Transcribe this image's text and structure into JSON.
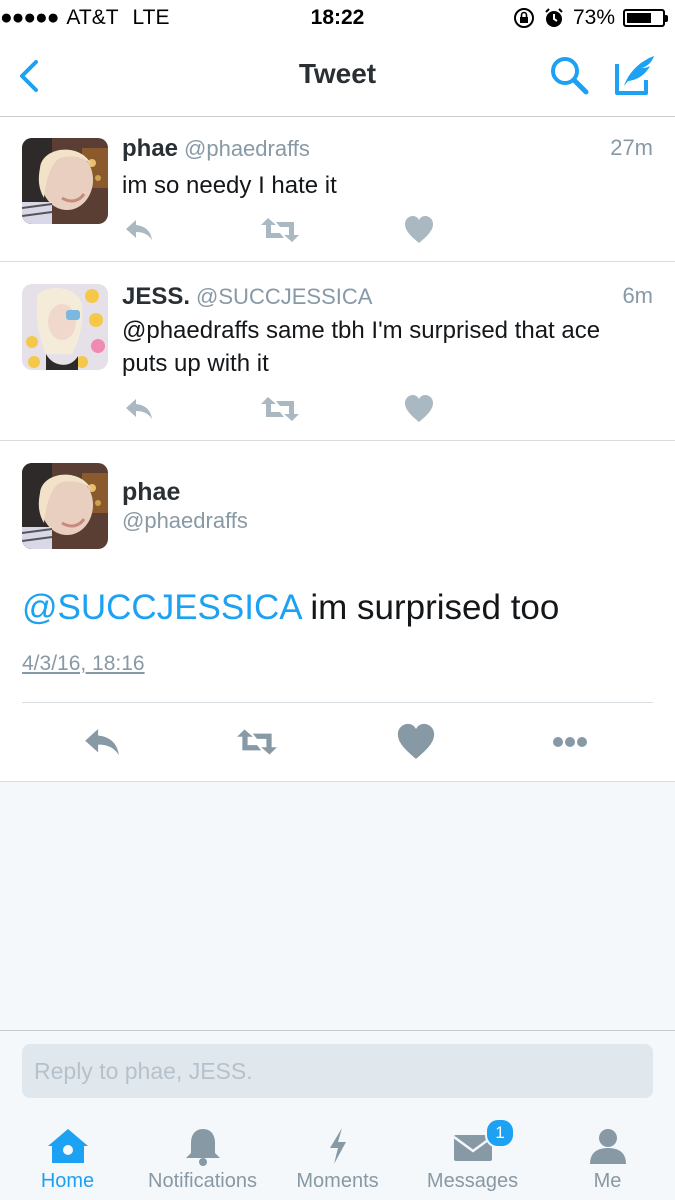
{
  "status_bar": {
    "signal": "●●●●●",
    "carrier": "AT&T",
    "network": "LTE",
    "time": "18:22",
    "battery": "73%",
    "battery_level": 0.73
  },
  "nav": {
    "title": "Tweet",
    "back_icon": "chevron-left-icon",
    "search_icon": "search-icon",
    "compose_icon": "compose-icon"
  },
  "tweets": [
    {
      "name": "phae",
      "handle": "@phaedraffs",
      "time": "27m",
      "text": "im so needy I hate it"
    },
    {
      "name": "JESS.",
      "handle": "@SUCCJESSICA",
      "time": "6m",
      "text": "@phaedraffs same tbh I'm surprised that ace puts up with it"
    }
  ],
  "main_tweet": {
    "name": "phae",
    "handle": "@phaedraffs",
    "mention": "@SUCCJESSICA",
    "text": " im surprised too",
    "date": "4/3/16, 18:16"
  },
  "reply": {
    "placeholder": "Reply to phae, JESS."
  },
  "tabs": [
    {
      "label": "Home",
      "icon": "home-icon",
      "active": true
    },
    {
      "label": "Notifications",
      "icon": "bell-icon",
      "active": false
    },
    {
      "label": "Moments",
      "icon": "lightning-icon",
      "active": false
    },
    {
      "label": "Messages",
      "icon": "envelope-icon",
      "active": false,
      "badge": "1"
    },
    {
      "label": "Me",
      "icon": "person-icon",
      "active": false
    }
  ],
  "colors": {
    "accent": "#1da1f2",
    "text": "#14171a",
    "muted": "#8899a6",
    "icon": "#aab8c2",
    "background_grey": "#f5f8fa"
  }
}
